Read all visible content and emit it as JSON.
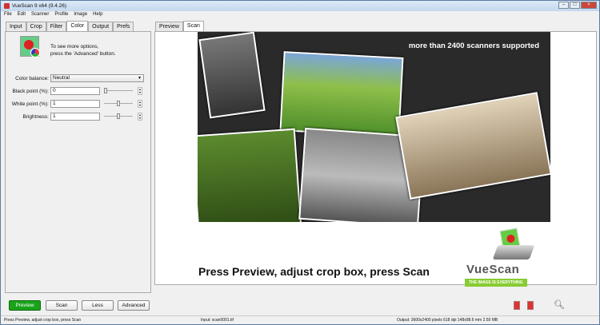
{
  "window": {
    "title": "VueScan 9 x64 (9.4.26)"
  },
  "menu": [
    "File",
    "Edit",
    "Scanner",
    "Profile",
    "Image",
    "Help"
  ],
  "left_tabs": [
    "Input",
    "Crop",
    "Filter",
    "Color",
    "Output",
    "Prefs"
  ],
  "left_active": "Color",
  "right_tabs": [
    "Preview",
    "Scan"
  ],
  "right_active": "Scan",
  "hint": {
    "line1": "To see more options,",
    "line2": "press the 'Advanced' button."
  },
  "fields": {
    "color_balance": {
      "label": "Color balance:",
      "value": "Neutral"
    },
    "black_point": {
      "label": "Black point (%):",
      "value": "0",
      "slider": 0
    },
    "white_point": {
      "label": "White point (%):",
      "value": "1",
      "slider": 0.5
    },
    "brightness": {
      "label": "Brightness:",
      "value": "1",
      "slider": 0.5
    }
  },
  "banner": {
    "tagline": "more than 2400 scanners supported",
    "message": "Press Preview, adjust crop box, press Scan",
    "logo": "VueScan",
    "logo_slogan": "THE IMAGE IS EVERYTHING"
  },
  "buttons": {
    "preview": "Preview",
    "scan": "Scan",
    "less": "Less",
    "advanced": "Advanced"
  },
  "status": {
    "left": "Press Preview, adjust crop box, press Scan",
    "middle": "Input: scan0001.tif",
    "right": "Output: 3600x2400 pixels 618 dpi 148x98.6 mm 2.59 MB"
  },
  "colors": {
    "preview_button": "#1aa31a"
  }
}
